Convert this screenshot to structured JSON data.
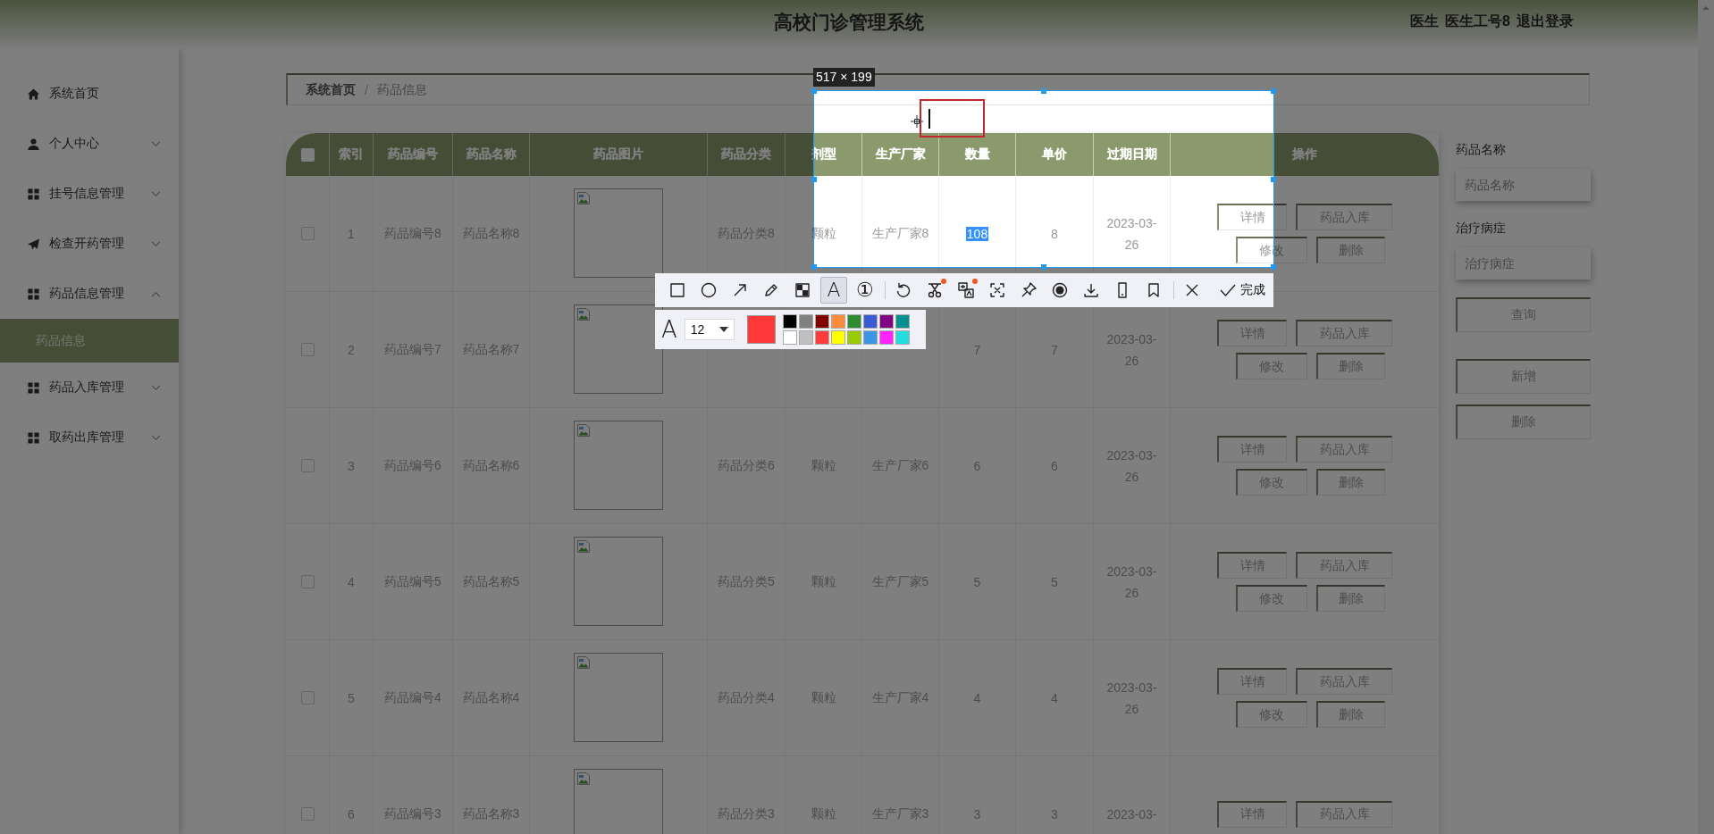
{
  "header": {
    "title": "高校门诊管理系统",
    "user_role": "医生",
    "user_name": "医生工号8",
    "logout": "退出登录"
  },
  "sidebar": {
    "items": [
      {
        "label": "系统首页",
        "expandable": false
      },
      {
        "label": "个人中心",
        "expandable": true,
        "expanded": false
      },
      {
        "label": "挂号信息管理",
        "expandable": true,
        "expanded": false
      },
      {
        "label": "检查开药管理",
        "expandable": true,
        "expanded": false
      },
      {
        "label": "药品信息管理",
        "expandable": true,
        "expanded": true,
        "children": [
          {
            "label": "药品信息",
            "selected": true
          }
        ]
      },
      {
        "label": "药品入库管理",
        "expandable": true,
        "expanded": false
      },
      {
        "label": "取药出库管理",
        "expandable": true,
        "expanded": false
      }
    ]
  },
  "breadcrumb": {
    "items": [
      "系统首页",
      "药品信息"
    ],
    "separator": "/"
  },
  "table": {
    "select_all": false,
    "columns": [
      "索引",
      "药品编号",
      "药品名称",
      "药品图片",
      "药品分类",
      "剂型",
      "生产厂家",
      "数量",
      "单价",
      "过期日期",
      "操作"
    ],
    "rows": [
      {
        "checked": false,
        "index": "1",
        "code": "药品编号8",
        "name": "药品名称8",
        "category": "药品分类8",
        "form": "颗粒",
        "maker": "生产厂家8",
        "quantity": "108",
        "quantity_highlighted": true,
        "price": "8",
        "expiry": "2023-03-26",
        "actions": [
          "详情",
          "药品入库",
          "修改",
          "删除"
        ]
      },
      {
        "checked": false,
        "index": "2",
        "code": "药品编号7",
        "name": "药品名称7",
        "quantity": "7",
        "quantity_highlighted": false,
        "price": "7",
        "expiry": "2023-03-26",
        "actions": [
          "详情",
          "药品入库",
          "修改",
          "删除"
        ]
      },
      {
        "checked": false,
        "index": "3",
        "code": "药品编号6",
        "name": "药品名称6",
        "category": "药品分类6",
        "form": "颗粒",
        "maker": "生产厂家6",
        "quantity": "6",
        "quantity_highlighted": false,
        "price": "6",
        "expiry": "2023-03-26",
        "actions": [
          "详情",
          "药品入库",
          "修改",
          "删除"
        ]
      },
      {
        "checked": false,
        "index": "4",
        "code": "药品编号5",
        "name": "药品名称5",
        "category": "药品分类5",
        "form": "颗粒",
        "maker": "生产厂家5",
        "quantity": "5",
        "quantity_highlighted": false,
        "price": "5",
        "expiry": "2023-03-26",
        "actions": [
          "详情",
          "药品入库",
          "修改",
          "删除"
        ]
      },
      {
        "checked": false,
        "index": "5",
        "code": "药品编号4",
        "name": "药品名称4",
        "category": "药品分类4",
        "form": "颗粒",
        "maker": "生产厂家4",
        "quantity": "4",
        "quantity_highlighted": false,
        "price": "4",
        "expiry": "2023-03-26",
        "actions": [
          "详情",
          "药品入库",
          "修改",
          "删除"
        ]
      },
      {
        "checked": false,
        "index": "6",
        "code": "药品编号3",
        "name": "药品名称3",
        "category": "药品分类3",
        "form": "颗粒",
        "maker": "生产厂家3",
        "quantity": "3",
        "quantity_highlighted": false,
        "price": "3",
        "expiry": "2023-03-",
        "actions": [
          "详情",
          "药品入库"
        ]
      }
    ]
  },
  "search_panel": {
    "fields": [
      {
        "label": "药品名称",
        "placeholder": "药品名称"
      },
      {
        "label": "治疗病症",
        "placeholder": "治疗病症"
      }
    ],
    "buttons": [
      "查询",
      "新增",
      "删除"
    ]
  },
  "capture": {
    "size_label": "517 × 199",
    "tools": [
      {
        "selected": false,
        "dot": false
      },
      {
        "selected": false,
        "dot": false
      },
      {
        "selected": false,
        "dot": false
      },
      {
        "selected": false,
        "dot": false
      },
      {
        "selected": false,
        "dot": false
      },
      {
        "selected": true,
        "dot": false,
        "glyph": "A"
      },
      {
        "selected": false,
        "dot": false,
        "glyph": "①"
      },
      {
        "selected": false,
        "dot": false
      },
      {
        "selected": false,
        "dot": true
      },
      {
        "selected": false,
        "dot": true
      },
      {
        "selected": false,
        "dot": false
      },
      {
        "selected": false,
        "dot": false
      },
      {
        "selected": false,
        "dot": false
      },
      {
        "selected": false,
        "dot": false
      },
      {
        "selected": false,
        "dot": false
      },
      {
        "selected": false,
        "dot": false
      },
      {
        "selected": false,
        "dot": false
      }
    ],
    "done": "完成",
    "font_glyph": "A",
    "font_size": "12",
    "current": {
      "color": "#ff3838"
    },
    "palette": [
      {
        "color": "#000000"
      },
      {
        "color": "#808080"
      },
      {
        "color": "#800000"
      },
      {
        "color": "#ff8c3c"
      },
      {
        "color": "#2e8b2e"
      },
      {
        "color": "#3c5ad2"
      },
      {
        "color": "#800080"
      },
      {
        "color": "#009090"
      },
      {
        "color": "#ffffff"
      },
      {
        "color": "#c0c0c0"
      },
      {
        "color": "#ff3c3c"
      },
      {
        "color": "#ffff00"
      },
      {
        "color": "#99cc00"
      },
      {
        "color": "#3c96e6"
      },
      {
        "color": "#ff22ff"
      },
      {
        "color": "#22dddd"
      }
    ]
  }
}
